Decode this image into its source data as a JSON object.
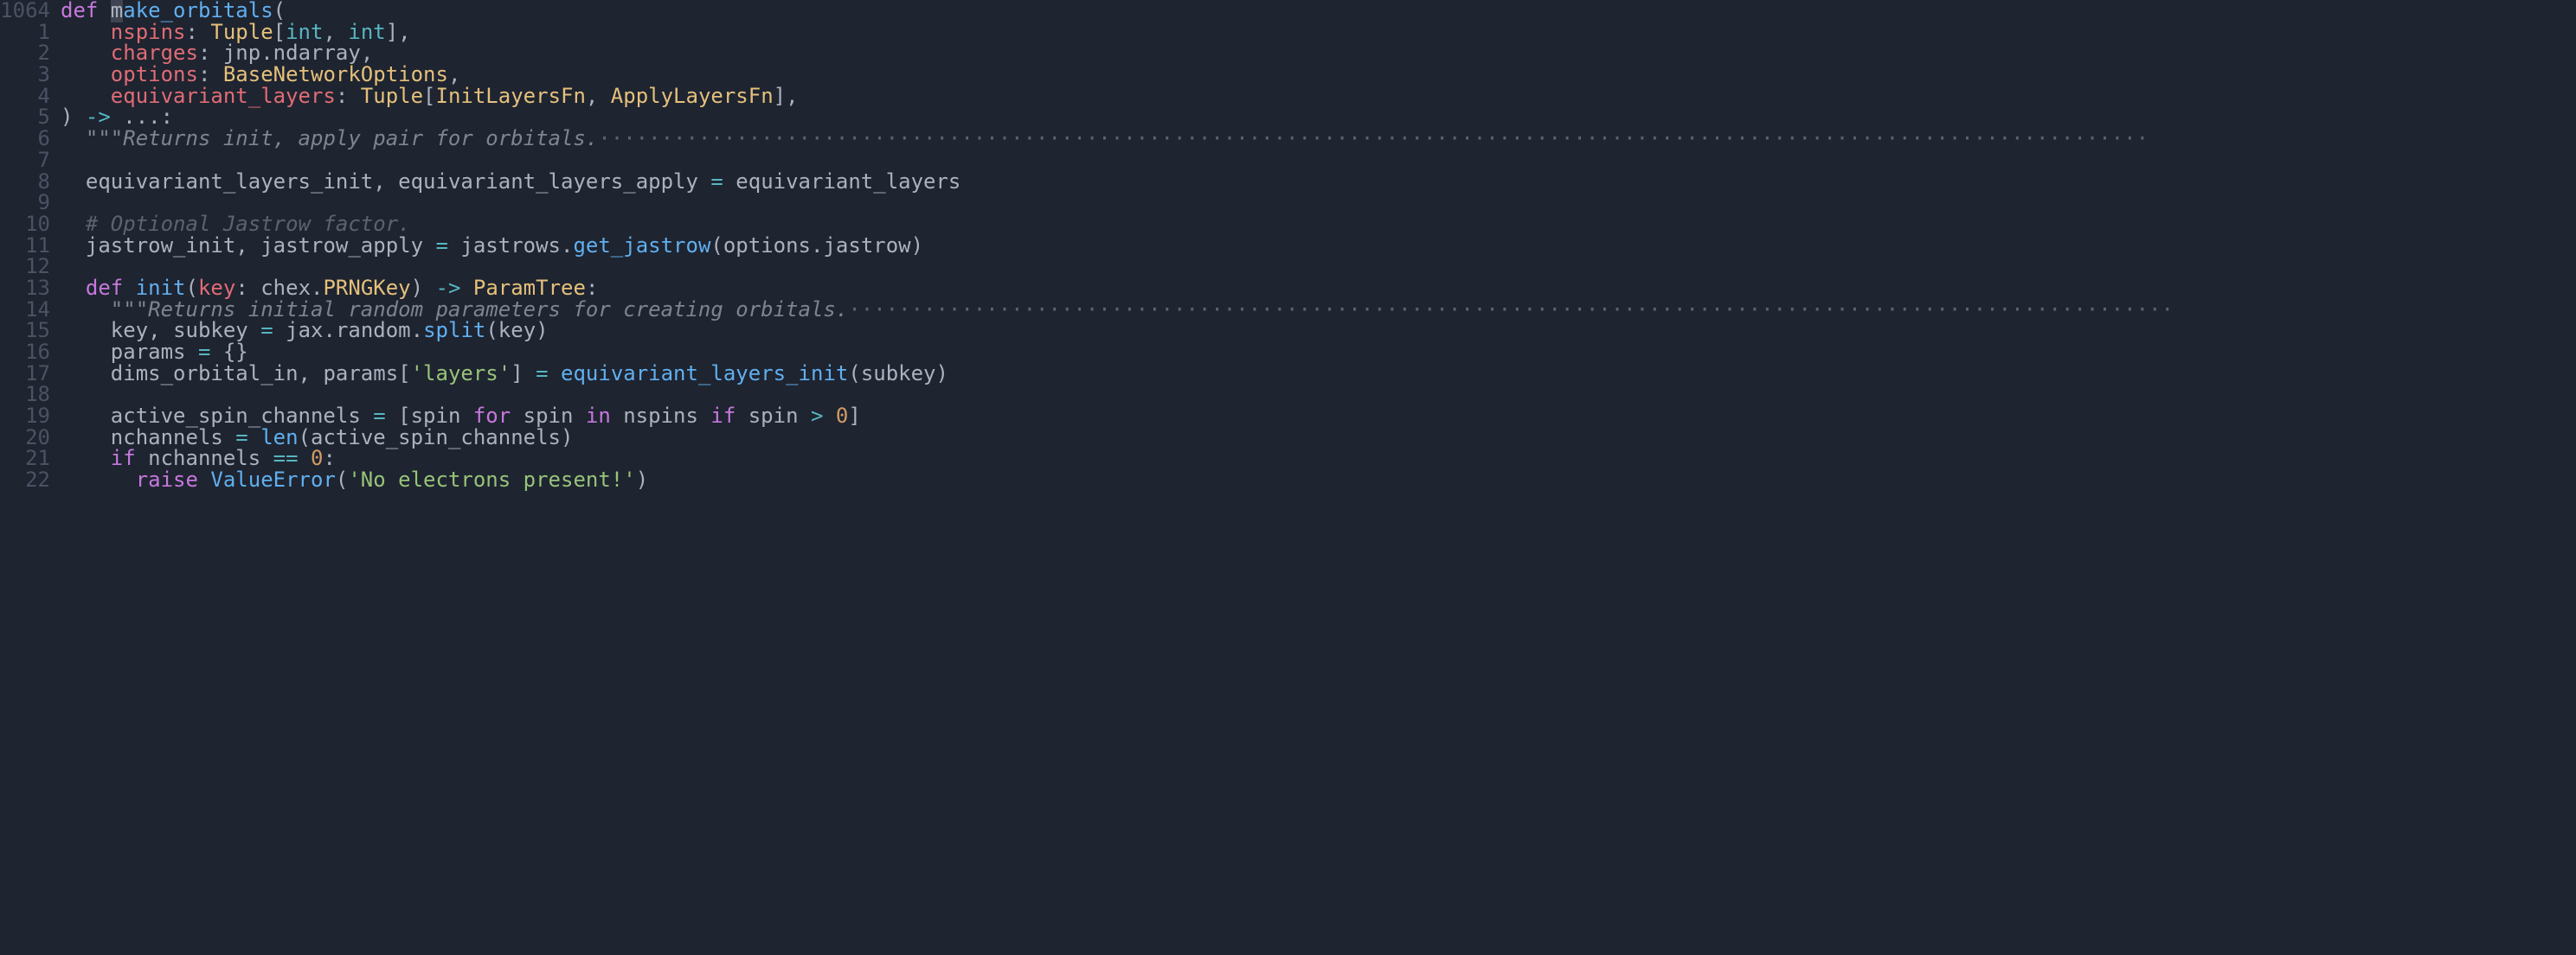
{
  "gutter": [
    "1064",
    "1",
    "2",
    "3",
    "4",
    "5",
    "6",
    "7",
    "8",
    "9",
    "10",
    "11",
    "12",
    "13",
    "14",
    "15",
    "16",
    "17",
    "18",
    "19",
    "20",
    "21",
    "22"
  ],
  "code": {
    "l0": {
      "kw_def": "def ",
      "fn": "ake_orbitals",
      "cursor": "m",
      "open": "("
    },
    "l1": {
      "indent": "    ",
      "param": "nspins",
      "colon": ": ",
      "type": "Tuple",
      "br": "[",
      "t1": "int",
      "comma": ", ",
      "t2": "int",
      "brc": "],"
    },
    "l2": {
      "indent": "    ",
      "param": "charges",
      "colon": ": ",
      "ns": "jnp",
      "dot": ".",
      "prop": "ndarray",
      "comma": ","
    },
    "l3": {
      "indent": "    ",
      "param": "options",
      "colon": ": ",
      "type": "BaseNetworkOptions",
      "comma": ","
    },
    "l4": {
      "indent": "    ",
      "param": "equivariant_layers",
      "colon": ": ",
      "type": "Tuple",
      "br": "[",
      "t1": "InitLayersFn",
      "comma": ", ",
      "t2": "ApplyLayersFn",
      "brc": "],"
    },
    "l5": {
      "close": ") ",
      "arrow": "->",
      " ellipsis": " ...",
      "colon": ":"
    },
    "l6": {
      "indent": "  ",
      "doc": "\"\"\"Returns init, apply pair for orbitals.",
      "dots": "····························································································································"
    },
    "l7": {
      "blank": ""
    },
    "l8": {
      "indent": "  ",
      "v1": "equivariant_layers_init",
      "comma": ", ",
      "v2": "equivariant_layers_apply",
      "eq": " = ",
      "rhs": "equivariant_layers"
    },
    "l9": {
      "blank": ""
    },
    "l10": {
      "indent": "  ",
      "comment": "# Optional Jastrow factor."
    },
    "l11": {
      "indent": "  ",
      "v1": "jastrow_init",
      "comma": ", ",
      "v2": "jastrow_apply",
      "eq": " = ",
      "ns": "jastrows",
      "dot": ".",
      "fn": "get_jastrow",
      "open": "(",
      "arg1": "options",
      "dot2": ".",
      "prop": "jastrow",
      "close": ")"
    },
    "l12": {
      "blank": ""
    },
    "l13": {
      "indent": "  ",
      "kw": "def ",
      "fn": "init",
      "open": "(",
      "param": "key",
      "colon": ": ",
      "ns": "chex",
      "dot": ".",
      "type": "PRNGKey",
      "close": ") ",
      "arrow": "->",
      " ret": " ParamTree",
      "colon2": ":"
    },
    "l14": {
      "indent": "    ",
      "doc": "\"\"\"Returns initial random parameters for creating orbitals.",
      "dots": "··········································································································"
    },
    "l15": {
      "indent": "    ",
      "v1": "key",
      "comma": ", ",
      "v2": "subkey",
      "eq": " = ",
      "ns": "jax",
      "dot": ".",
      "p1": "random",
      "dot2": ".",
      "fn": "split",
      "open": "(",
      "arg": "key",
      "close": ")"
    },
    "l16": {
      "indent": "    ",
      "v1": "params",
      "eq": " = ",
      "braces": "{}"
    },
    "l17": {
      "indent": "    ",
      "v1": "dims_orbital_in",
      "comma": ", ",
      "v2": "params",
      "br": "[",
      "str": "'layers'",
      "brc": "]",
      "eq": " = ",
      "fn": "equivariant_layers_init",
      "open": "(",
      "arg": "subkey",
      "close": ")"
    },
    "l18": {
      "blank": ""
    },
    "l19": {
      "indent": "    ",
      "v1": "active_spin_channels",
      "eq": " = ",
      "br": "[",
      "v2": "spin",
      "for": " for ",
      "v3": "spin",
      "in": " in ",
      "v4": "nspins",
      "if": " if ",
      "v5": "spin",
      "op": " > ",
      "num": "0",
      "brc": "]"
    },
    "l20": {
      "indent": "    ",
      "v1": "nchannels",
      "eq": " = ",
      "fn": "len",
      "open": "(",
      "arg": "active_spin_channels",
      "close": ")"
    },
    "l21": {
      "indent": "    ",
      "kw": "if ",
      "v1": "nchannels",
      "op": " == ",
      "num": "0",
      "colon": ":"
    },
    "l22": {
      "indent": "      ",
      "kw": "raise ",
      "exc": "ValueError",
      "open": "(",
      "str": "'No electrons present!'",
      "close": ")"
    }
  }
}
